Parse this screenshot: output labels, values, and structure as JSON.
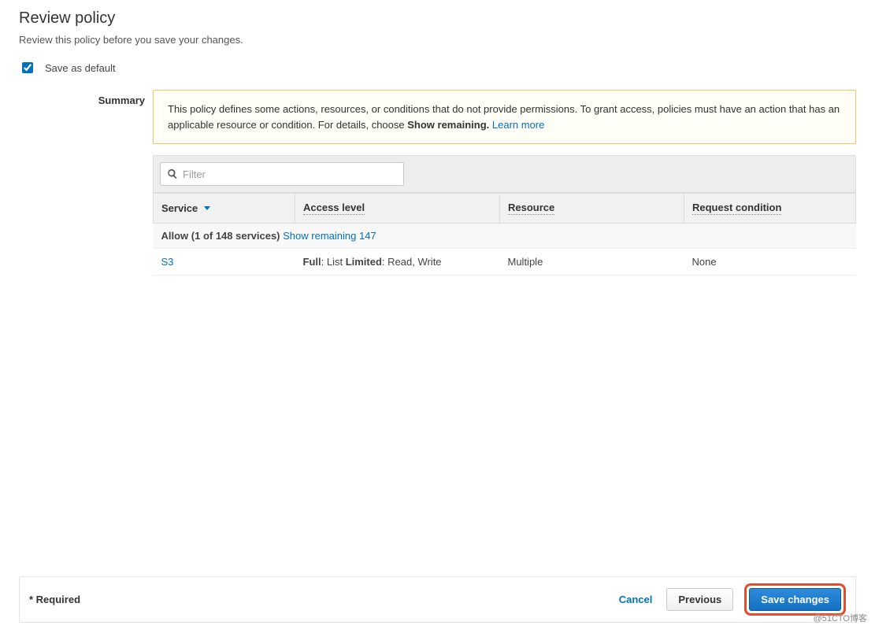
{
  "header": {
    "title": "Review policy",
    "subtitle": "Review this policy before you save your changes."
  },
  "save_default": {
    "label": "Save as default",
    "checked": true
  },
  "summary": {
    "label": "Summary",
    "alert": {
      "text_before": "This policy defines some actions, resources, or conditions that do not provide permissions. To grant access, policies must have an action that has an applicable resource or condition. For details, choose ",
      "bold": "Show remaining.",
      "link": "Learn more"
    },
    "filter_placeholder": "Filter",
    "columns": {
      "service": "Service",
      "access": "Access level",
      "resource": "Resource",
      "request": "Request condition"
    },
    "allow_group": {
      "bold": "Allow (1 of 148 services)",
      "link": "Show remaining 147"
    },
    "rows": [
      {
        "service": "S3",
        "access_full_label": "Full",
        "access_full_value": ": List ",
        "access_limited_label": "Limited",
        "access_limited_value": ": Read, Write",
        "resource": "Multiple",
        "request": "None"
      }
    ]
  },
  "footer": {
    "required": "* Required",
    "cancel": "Cancel",
    "previous": "Previous",
    "save": "Save changes"
  },
  "watermark": "@51CTO博客"
}
